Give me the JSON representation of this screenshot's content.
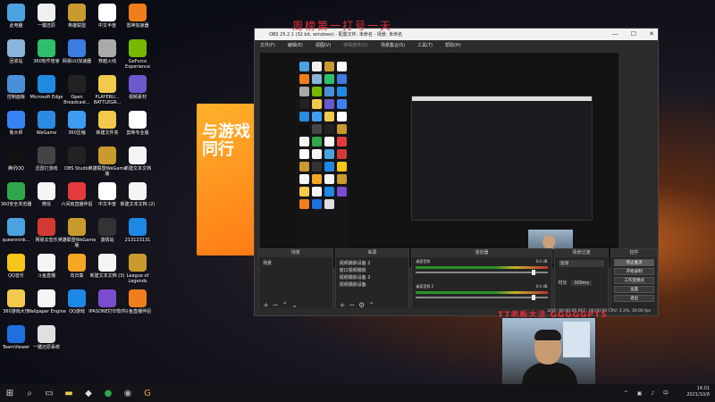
{
  "desktop": {
    "icons": [
      {
        "label": "此电脑",
        "color": "#4aa3e0"
      },
      {
        "label": "一键还原",
        "color": "#f0f0f0"
      },
      {
        "label": "英雄联盟",
        "color": "#c99a2e"
      },
      {
        "label": "中文半度",
        "color": "#ffffff"
      },
      {
        "label": "雷神加速器",
        "color": "#f07e1a"
      },
      {
        "label": "回收站",
        "color": "#8ab4d8"
      },
      {
        "label": "360软件管家",
        "color": "#2ec06a"
      },
      {
        "label": "网易UU加速器",
        "color": "#3c7be0"
      },
      {
        "label": "穿越火线",
        "color": "#aaaaaa"
      },
      {
        "label": "GeForce Experience",
        "color": "#76b900"
      },
      {
        "label": "控制面板",
        "color": "#4a90d9"
      },
      {
        "label": "Microsoft Edge",
        "color": "#1f8be0"
      },
      {
        "label": "Open Broadcast...",
        "color": "#222222"
      },
      {
        "label": "PLAYERU... BATTLEGR...",
        "color": "#f2c94c"
      },
      {
        "label": "视频素材",
        "color": "#6a5acd"
      },
      {
        "label": "鲁大师",
        "color": "#3b82f6"
      },
      {
        "label": "WeGame",
        "color": "#2b8be0"
      },
      {
        "label": "360压缩",
        "color": "#3d9df0"
      },
      {
        "label": "新建文件夹",
        "color": "#f2c94c"
      },
      {
        "label": "剪映专业版",
        "color": "#ffffff"
      },
      {
        "label": "腾讯QQ",
        "color": "#111111"
      },
      {
        "label": "迅雷打游戏",
        "color": "#444444"
      },
      {
        "label": "OBS Studio",
        "color": "#222222"
      },
      {
        "label": "英雄联盟WeGame版",
        "color": "#c99a2e"
      },
      {
        "label": "新建文本文档",
        "color": "#f5f5f5"
      },
      {
        "label": "360安全浏览器",
        "color": "#2ea84a"
      },
      {
        "label": "微信",
        "color": "#f5f5f5"
      },
      {
        "label": "六间房直播伴侣",
        "color": "#e33b3b"
      },
      {
        "label": "中文半度",
        "color": "#ffffff"
      },
      {
        "label": "新建文本文档 (2)",
        "color": "#f5f5f5"
      },
      {
        "label": "queennink...",
        "color": "#4aa3e0"
      },
      {
        "label": "网易云音乐",
        "color": "#d33a31"
      },
      {
        "label": "英雄联盟WeGame版",
        "color": "#c99a2e"
      },
      {
        "label": "激情站",
        "color": "#333333"
      },
      {
        "label": "213123131",
        "color": "#1e88e5"
      },
      {
        "label": "QQ音乐",
        "color": "#f5c518"
      },
      {
        "label": "斗鱼直播",
        "color": "#f5f5f5"
      },
      {
        "label": "向日葵",
        "color": "#f5a623"
      },
      {
        "label": "新建文本文档 (3)",
        "color": "#f5f5f5"
      },
      {
        "label": "League of Legends",
        "color": "#c99a2e"
      },
      {
        "label": "360游戏大厅",
        "color": "#f2c94c"
      },
      {
        "label": "Wallpaper Engine",
        "color": "#f5f5f5"
      },
      {
        "label": "QQ游戏",
        "color": "#1e88e5"
      },
      {
        "label": "IPASONE打印软件",
        "color": "#7a4dd0"
      },
      {
        "label": "斗鱼直播伴侣",
        "color": "#f07e1a"
      },
      {
        "label": "TeamViewer",
        "color": "#1e6fe0"
      },
      {
        "label": "一键还原系统",
        "color": "#e0e0e0"
      }
    ]
  },
  "poster": {
    "text_line1": "与游戏",
    "text_line2": "同行"
  },
  "overlay": {
    "top_text": "周榜第一打号一天",
    "bottom_text": "TT老板大法 GGGGGPTS"
  },
  "obs": {
    "title": "OBS 25.2.1 (32 bit, windows) - 配置文件: 未命名 - 场景: 未命名",
    "window_buttons": {
      "minimize": "—",
      "maximize": "☐",
      "close": "✕"
    },
    "menu": [
      "文件(F)",
      "编辑(E)",
      "视图(V)",
      "停靠部件(D)",
      "场景集合(S)",
      "工具(T)",
      "帮助(H)"
    ],
    "docks": {
      "scenes": {
        "title": "场景",
        "items": [
          "场景"
        ]
      },
      "sources": {
        "title": "来源",
        "items": [
          "视频捕获设备 2",
          "窗口视频捕获",
          "视频捕获设备 2",
          "视频捕获设备"
        ]
      },
      "mixer": {
        "title": "混音器",
        "tracks": [
          {
            "name": "桌面音频",
            "level": "0.0 dB"
          },
          {
            "name": "桌面音频 2",
            "level": "0.0 dB"
          }
        ]
      },
      "transitions": {
        "title": "场景过渡",
        "type": "淡出",
        "duration_label": "时长",
        "duration": "300ms"
      },
      "controls": {
        "title": "控件",
        "buttons": [
          "停止推流",
          "开始录制",
          "工作室模式",
          "设置",
          "退出"
        ]
      }
    },
    "status": "LIVE: 00:00:00  REC: 00:00:00  CPU: 3.3%, 30.00 fps"
  },
  "taskbar": {
    "start": "⊞",
    "search": "⌕",
    "time": "14:01",
    "date": "2021/10/8",
    "tray": "^ ▣ ♪ 中"
  }
}
